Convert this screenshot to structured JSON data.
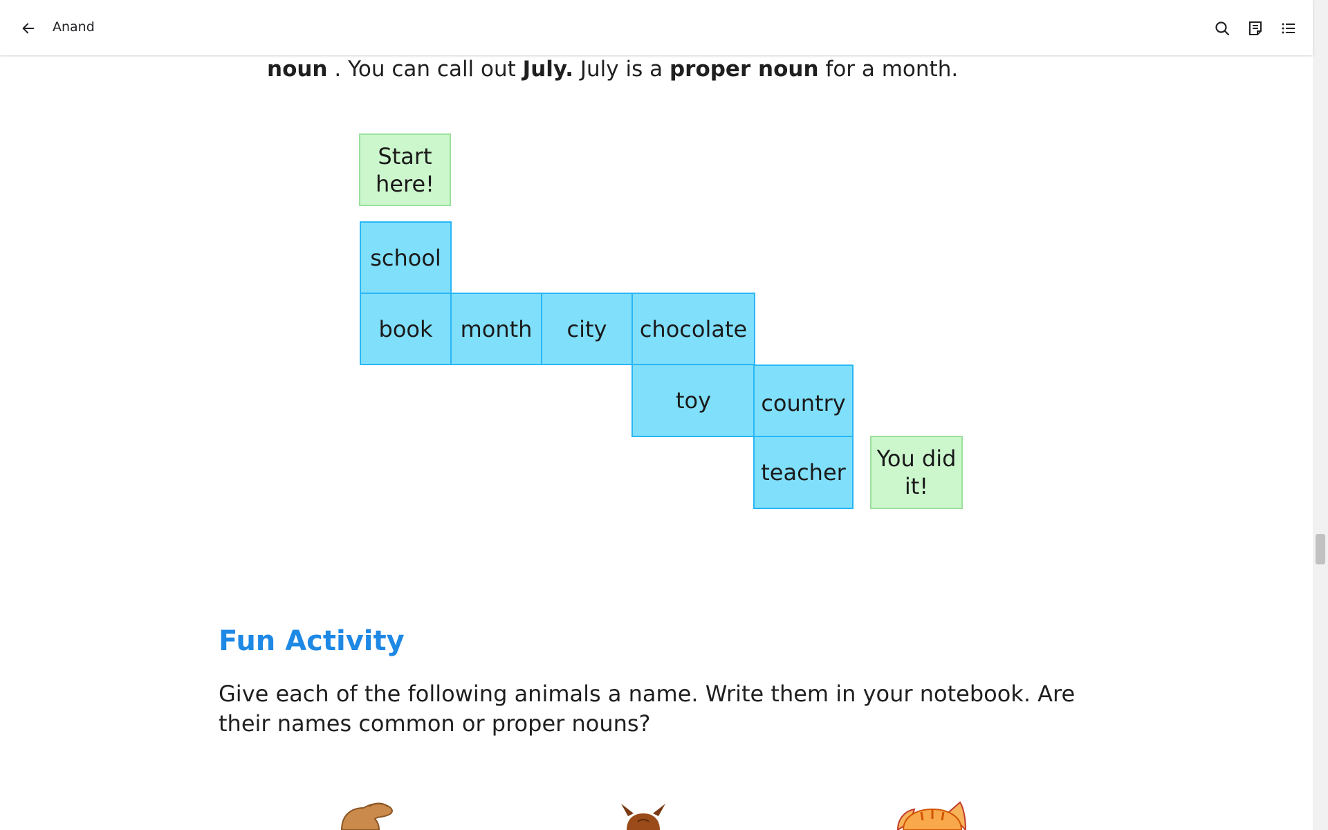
{
  "header": {
    "back_label": "Back",
    "book_title": "Anand",
    "icons": [
      "arrow-left-icon",
      "search-icon",
      "notes-icon",
      "contents-icon"
    ]
  },
  "sentence": {
    "part1": "noun",
    "part2": " . You can call out ",
    "part3": "July.",
    "part4": " July is a ",
    "part5": "proper noun",
    "part6": " for a month."
  },
  "maze": {
    "start": "Start here!",
    "end": "You did it!",
    "cells": [
      "school",
      "book",
      "month",
      "city",
      "chocolate",
      "toy",
      "country",
      "teacher"
    ],
    "colors": {
      "cell_fill": "#80dffa",
      "cell_border": "#29b6f6",
      "endpoint_fill": "#ccf7cc",
      "endpoint_border": "#9be09b"
    }
  },
  "activity": {
    "title": "Fun Activity",
    "instruction": "Give each of the following animals a name. Write them in your notebook. Are their names common or proper nouns?",
    "title_color": "#1e88e5"
  },
  "animals": [
    "dog-illustration",
    "squirrel-illustration",
    "cat-illustration"
  ]
}
